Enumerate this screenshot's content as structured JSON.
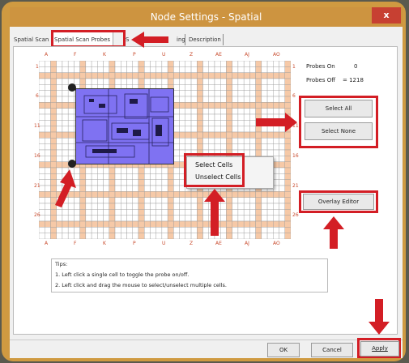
{
  "window": {
    "title": "Node Settings - Spatial",
    "close_label": "x"
  },
  "tabs": [
    {
      "label": "Spatial Scan",
      "active": false
    },
    {
      "label": "Spatial Scan Probes",
      "active": true
    },
    {
      "label": "S",
      "active": false
    },
    {
      "label": "ing",
      "active": false
    },
    {
      "label": "Description",
      "active": false
    }
  ],
  "grid": {
    "columns": [
      "A",
      "F",
      "K",
      "P",
      "U",
      "Z",
      "AE",
      "AJ",
      "AO"
    ],
    "rows": [
      "1",
      "6",
      "11",
      "16",
      "21",
      "26"
    ],
    "cell_color": "#f6c9a7",
    "line_color": "#9a9a9a",
    "selection_color": "#7f72f2"
  },
  "probes": {
    "on_label": "Probes On",
    "on_value": "0",
    "off_label": "Probes Off",
    "off_value": "= 1218"
  },
  "buttons": {
    "select_all": "Select All",
    "select_none": "Select None",
    "overlay_editor": "Overlay Editor",
    "ok": "OK",
    "cancel": "Cancel",
    "apply": "Apply"
  },
  "context_menu": {
    "select": "Select Cells",
    "unselect": "Unselect Cells"
  },
  "tips": {
    "title": "Tips:",
    "line1": "1. Left click a single cell to toggle the probe on/off.",
    "line2": "2. Left click and drag the mouse to select/unselect multiple cells."
  },
  "colors": {
    "highlight": "#d31e25",
    "title_bar": "#cd9440"
  }
}
